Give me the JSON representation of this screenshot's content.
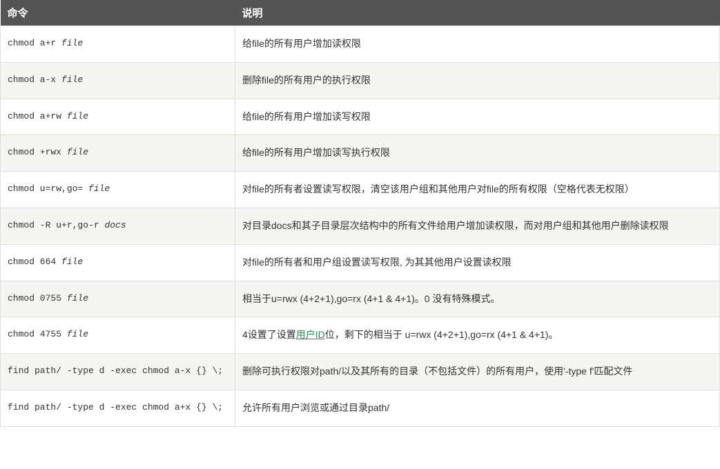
{
  "headers": {
    "command": "命令",
    "description": "说明"
  },
  "rows": [
    {
      "cmd_prefix": "chmod a+r ",
      "cmd_arg": "file",
      "cmd_suffix": "",
      "desc_before": "给file的所有用户增加读权限",
      "link_text": "",
      "desc_after": ""
    },
    {
      "cmd_prefix": "chmod a-x ",
      "cmd_arg": "file",
      "cmd_suffix": "",
      "desc_before": "删除file的所有用户的执行权限",
      "link_text": "",
      "desc_after": ""
    },
    {
      "cmd_prefix": "chmod a+rw ",
      "cmd_arg": "file",
      "cmd_suffix": "",
      "desc_before": "给file的所有用户增加读写权限",
      "link_text": "",
      "desc_after": ""
    },
    {
      "cmd_prefix": "chmod +rwx ",
      "cmd_arg": "file",
      "cmd_suffix": "",
      "desc_before": "给file的所有用户增加读写执行权限",
      "link_text": "",
      "desc_after": ""
    },
    {
      "cmd_prefix": "chmod u=rw,go= ",
      "cmd_arg": "file",
      "cmd_suffix": "",
      "desc_before": "对file的所有者设置读写权限，清空该用户组和其他用户对file的所有权限（空格代表无权限）",
      "link_text": "",
      "desc_after": ""
    },
    {
      "cmd_prefix": "chmod -R u+r,go-r ",
      "cmd_arg": "docs",
      "cmd_suffix": "",
      "desc_before": "对目录docs和其子目录层次结构中的所有文件给用户增加读权限，而对用户组和其他用户删除读权限",
      "link_text": "",
      "desc_after": ""
    },
    {
      "cmd_prefix": "chmod 664 ",
      "cmd_arg": "file",
      "cmd_suffix": "",
      "desc_before": "对file的所有者和用户组设置读写权限, 为其其他用户设置读权限",
      "link_text": "",
      "desc_after": ""
    },
    {
      "cmd_prefix": "chmod 0755 ",
      "cmd_arg": "file",
      "cmd_suffix": "",
      "desc_before": "相当于u=rwx (4+2+1),go=rx (4+1 & 4+1)。0 没有特殊模式。",
      "link_text": "",
      "desc_after": ""
    },
    {
      "cmd_prefix": "chmod 4755 ",
      "cmd_arg": "file",
      "cmd_suffix": "",
      "desc_before": "4设置了设置",
      "link_text": "用户ID",
      "desc_after": "位，剩下的相当于 u=rwx (4+2+1),go=rx (4+1 & 4+1)。"
    },
    {
      "cmd_prefix": "find path/ -type d -exec chmod a-x {} \\;",
      "cmd_arg": "",
      "cmd_suffix": "",
      "desc_before": "删除可执行权限对path/以及其所有的目录（不包括文件）的所有用户，使用'-type f'匹配文件",
      "link_text": "",
      "desc_after": ""
    },
    {
      "cmd_prefix": "find path/ -type d -exec chmod a+x {} \\;",
      "cmd_arg": "",
      "cmd_suffix": "",
      "desc_before": "允许所有用户浏览或通过目录path/",
      "link_text": "",
      "desc_after": ""
    }
  ]
}
